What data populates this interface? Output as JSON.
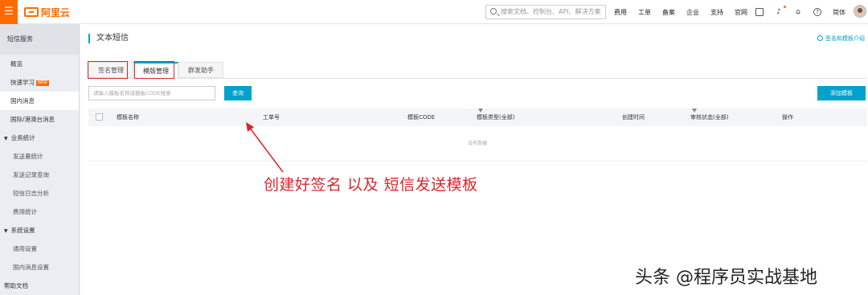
{
  "topbar": {
    "menu_icon": "menu-icon",
    "logo_text": "阿里云",
    "search_placeholder": "搜索文档、控制台、API、解决方案",
    "nav_links": [
      "费用",
      "工单",
      "备案",
      "企业",
      "支持",
      "官网"
    ],
    "language": "简体"
  },
  "sidebar": {
    "title": "短信服务",
    "items": [
      {
        "label": "概览",
        "type": "item"
      },
      {
        "label": "快速学习",
        "type": "item",
        "badge": "NEW"
      },
      {
        "label": "国内消息",
        "type": "item",
        "active": true
      },
      {
        "label": "国际/港澳台消息",
        "type": "item"
      },
      {
        "label": "业务统计",
        "type": "group"
      },
      {
        "label": "发送量统计",
        "type": "sub"
      },
      {
        "label": "发送记录查询",
        "type": "sub"
      },
      {
        "label": "短信日志分析",
        "type": "sub"
      },
      {
        "label": "费用统计",
        "type": "sub"
      },
      {
        "label": "系统设置",
        "type": "group"
      },
      {
        "label": "通用设置",
        "type": "sub"
      },
      {
        "label": "国内消息设置",
        "type": "sub"
      },
      {
        "label": "帮助文档",
        "type": "item"
      }
    ]
  },
  "main": {
    "page_title": "文本短信",
    "help_link": "签名和模板介绍",
    "tabs": [
      "签名管理",
      "模版管理",
      "群发助手"
    ],
    "active_tab": 1,
    "search_placeholder": "请输入模板名称或模板CODE搜索",
    "query_label": "查询",
    "add_label": "添加模板",
    "columns": [
      "模板名称",
      "工单号",
      "模板CODE",
      "模板类型(全部)",
      "创建时间",
      "审核状态(全部)",
      "操作"
    ],
    "empty_text": "没有数据"
  },
  "annotation": {
    "text": "创建好签名 以及  短信发送模板",
    "color": "#d9262c"
  },
  "watermark": "头条 @程序员实战基地",
  "colors": {
    "accent": "#00a2ca",
    "brand": "#ff6a00",
    "highlight": "#d9262c"
  }
}
